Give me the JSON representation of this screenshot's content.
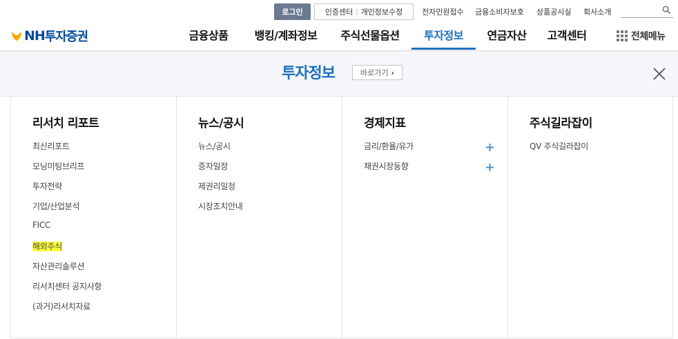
{
  "util": {
    "login": "로그인",
    "cert": "인증센터",
    "privacy": "개인정보수정",
    "links": [
      "전자민원접수",
      "금융소비자보호",
      "상품공시실",
      "회사소개"
    ],
    "search_placeholder": ""
  },
  "header": {
    "logo_prefix": "NH",
    "logo_suffix": "투자증권",
    "gnb": [
      "금융상품",
      "뱅킹/계좌정보",
      "주식선물옵션",
      "투자정보",
      "연금자산",
      "고객센터"
    ],
    "active_index": 3,
    "all_menu": "전체메뉴"
  },
  "band": {
    "title": "투자정보",
    "shortcut": "바로가기"
  },
  "columns": [
    {
      "title": "리서치 리포트",
      "items": [
        "최신리포트",
        "모닝미팅브리프",
        "투자전략",
        "기업/산업분석",
        "FICC",
        "해외주식",
        "자산관리솔루션",
        "리서치센터 공지사항",
        "(과거)리서치자료"
      ]
    },
    {
      "title": "뉴스/공시",
      "items": [
        "뉴스/공시",
        "증자일정",
        "제권리일정",
        "시장조치안내"
      ]
    },
    {
      "title": "경제지표",
      "items": [
        "금리/환율/유가",
        "채권시장동향"
      ]
    },
    {
      "title": "주식길라잡이",
      "items": [
        "QV 주식길라잡이"
      ]
    }
  ],
  "highlighted_item": "해외주식",
  "colors": {
    "brand_blue": "#004a9f",
    "active_blue": "#1d6fbf",
    "highlight": "#ffff3c",
    "plus_blue": "#4a90c8"
  }
}
